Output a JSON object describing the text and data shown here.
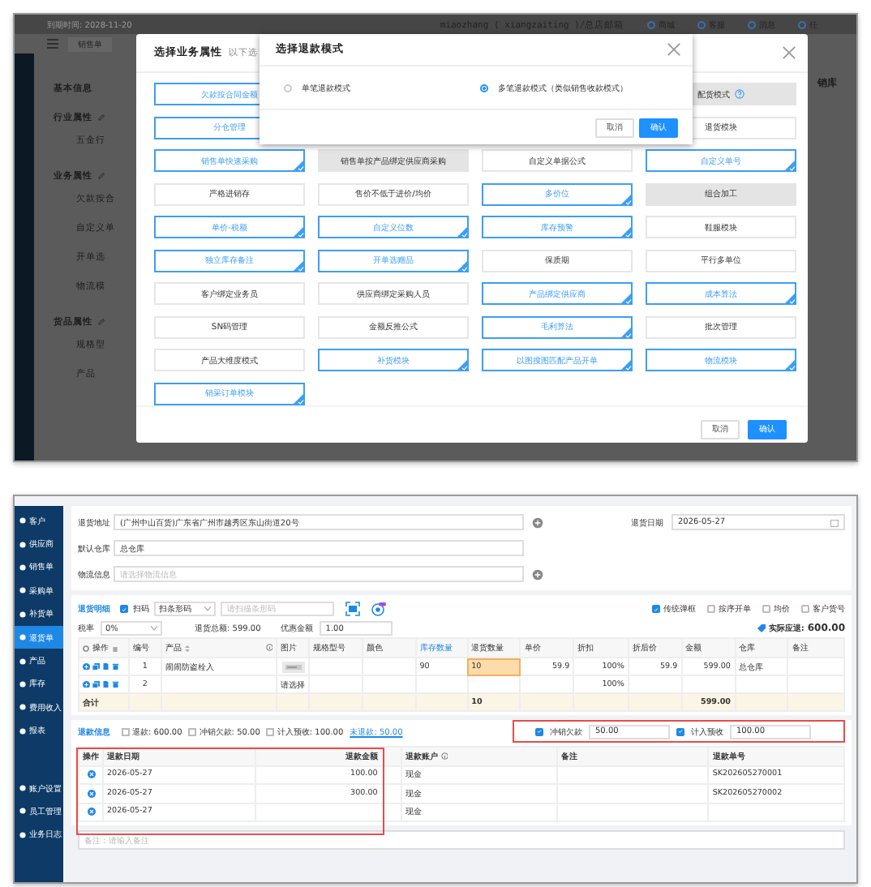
{
  "top_screen": {
    "background_page": {
      "expiry": "到期时间: 2028-11-20",
      "user": "miaozhang ( xiangzaiting )/总店邮箱",
      "nav": [
        "商城",
        "客服",
        "消息",
        "任"
      ],
      "tab": "销售单",
      "sections": [
        {
          "title": "基本信息",
          "editable": false
        },
        {
          "title": "行业属性",
          "editable": true,
          "fields": [
            "五金行"
          ]
        },
        {
          "title": "业务属性",
          "editable": true,
          "fields": [
            "欠款按合",
            "自定义单",
            "开单选",
            "物流模"
          ]
        },
        {
          "title": "货品属性",
          "editable": true,
          "fields": [
            "规格型",
            "产品"
          ]
        }
      ],
      "right_label": "销库"
    },
    "attribute_dialog": {
      "title": "选择业务属性",
      "subtitle": "以下选",
      "rows": [
        [
          {
            "label": "欠款按合同金额",
            "selected": true,
            "disabled": false
          },
          {
            "label": "配货模式",
            "selected": false,
            "disabled": true,
            "help": true
          }
        ],
        [
          {
            "label": "分仓管理",
            "selected": true,
            "disabled": false
          },
          {
            "label": "退货模块",
            "selected": false,
            "disabled": false
          }
        ],
        [
          {
            "label": "销售单快速采购",
            "selected": true,
            "disabled": false
          },
          {
            "label": "销售单按产品绑定供应商采购",
            "selected": false,
            "disabled": true
          },
          {
            "label": "自定义单据公式",
            "selected": false,
            "disabled": false
          },
          {
            "label": "自定义单号",
            "selected": true,
            "disabled": false
          }
        ],
        [
          {
            "label": "严格进销存",
            "selected": false,
            "disabled": false
          },
          {
            "label": "售价不低于进价/均价",
            "selected": false,
            "disabled": false
          },
          {
            "label": "多价位",
            "selected": true,
            "disabled": false
          },
          {
            "label": "组合加工",
            "selected": false,
            "disabled": true
          }
        ],
        [
          {
            "label": "单价-税额",
            "selected": true,
            "disabled": false
          },
          {
            "label": "自定义位数",
            "selected": true,
            "disabled": false
          },
          {
            "label": "库存预警",
            "selected": true,
            "disabled": false
          },
          {
            "label": "鞋服模块",
            "selected": false,
            "disabled": false
          }
        ],
        [
          {
            "label": "独立库存备注",
            "selected": true,
            "disabled": false
          },
          {
            "label": "开单选赠品",
            "selected": true,
            "disabled": false
          },
          {
            "label": "保质期",
            "selected": false,
            "disabled": false
          },
          {
            "label": "平行多单位",
            "selected": false,
            "disabled": false
          }
        ],
        [
          {
            "label": "客户绑定业务员",
            "selected": false,
            "disabled": false
          },
          {
            "label": "供应商绑定采购人员",
            "selected": false,
            "disabled": false
          },
          {
            "label": "产品绑定供应商",
            "selected": true,
            "disabled": false
          },
          {
            "label": "成本算法",
            "selected": true,
            "disabled": false
          }
        ],
        [
          {
            "label": "SN码管理",
            "selected": false,
            "disabled": false
          },
          {
            "label": "金额反推公式",
            "selected": false,
            "disabled": false
          },
          {
            "label": "毛利算法",
            "selected": true,
            "disabled": false
          },
          {
            "label": "批次管理",
            "selected": false,
            "disabled": false
          }
        ],
        [
          {
            "label": "产品大维度模式",
            "selected": false,
            "disabled": false
          },
          {
            "label": "补货模块",
            "selected": true,
            "disabled": false
          },
          {
            "label": "以图搜图匹配产品开单",
            "selected": true,
            "disabled": false
          },
          {
            "label": "物流模块",
            "selected": true,
            "disabled": false
          }
        ],
        [
          {
            "label": "销采订单模块",
            "selected": true,
            "disabled": false
          }
        ]
      ],
      "buttons": [
        {
          "label": "取消",
          "kind": "secondary"
        },
        {
          "label": "确认",
          "kind": "primary"
        }
      ]
    },
    "refund_mode_dialog": {
      "title": "选择退款模式",
      "options": [
        {
          "label": "单笔退款模式",
          "selected": false
        },
        {
          "label": "多笔退款模式（类似销售收款模式）",
          "selected": true
        }
      ],
      "buttons": [
        {
          "label": "取消",
          "kind": "secondary"
        },
        {
          "label": "确认",
          "kind": "primary"
        }
      ]
    }
  },
  "bottom_screen": {
    "sidebar": [
      {
        "label": "客户",
        "selected": false
      },
      {
        "label": "供应商",
        "selected": false
      },
      {
        "label": "销售单",
        "selected": false
      },
      {
        "label": "采购单",
        "selected": false
      },
      {
        "label": "补货单",
        "selected": false
      },
      {
        "label": "退货单",
        "selected": true
      },
      {
        "label": "产品",
        "selected": false
      },
      {
        "label": "库存",
        "selected": false
      },
      {
        "label": "费用收入",
        "selected": false
      },
      {
        "label": "报表",
        "selected": false
      },
      {
        "label": "账户设置",
        "selected": false
      },
      {
        "label": "员工管理",
        "selected": false
      },
      {
        "label": "业务日志",
        "selected": false
      }
    ],
    "form": {
      "address": {
        "label": "退货地址",
        "value": "(广州中山百货)广东省广州市越秀区东山街道20号"
      },
      "date": {
        "label": "退货日期",
        "value": "2026-05-27"
      },
      "warehouse": {
        "label": "默认仓库",
        "value": "总仓库"
      },
      "logistics": {
        "label": "物流信息",
        "placeholder": "请选择物流信息"
      }
    },
    "toolbar": {
      "title": "退货明细",
      "scan": {
        "label": "扫码",
        "checked": true
      },
      "scan_mode": "扫条形码",
      "barcode_placeholder": "请扫描条形码",
      "options": [
        {
          "label": "传统弹框",
          "checked": true
        },
        {
          "label": "按序开单",
          "checked": false
        },
        {
          "label": "均价",
          "checked": false
        },
        {
          "label": "客户货号",
          "checked": false
        }
      ]
    },
    "totals": {
      "tax_label": "税率",
      "tax_value": "0%",
      "total": "退货总额: 599.00",
      "discount_label": "优惠金额",
      "discount_value": "1.00",
      "actual_label": "实际应退:",
      "actual_value": "600.00"
    },
    "items_table": {
      "columns": [
        {
          "label": "操作",
          "link": false
        },
        {
          "label": "编号",
          "link": false
        },
        {
          "label": "产品",
          "link": false
        },
        {
          "label": "图片",
          "link": false
        },
        {
          "label": "规格型号",
          "link": false
        },
        {
          "label": "颜色",
          "link": false
        },
        {
          "label": "库存数量",
          "link": true
        },
        {
          "label": "退货数量",
          "link": false
        },
        {
          "label": "单价",
          "link": false
        },
        {
          "label": "折扣",
          "link": false
        },
        {
          "label": "折后价",
          "link": false
        },
        {
          "label": "金额",
          "link": false
        },
        {
          "label": "仓库",
          "link": false
        },
        {
          "label": "备注",
          "link": false
        }
      ],
      "rows": [
        {
          "number": "1",
          "product": "闹闹防盗栓入",
          "stock": "90",
          "quantity": "10",
          "price": "59.9",
          "discount": "100%",
          "net_price": "59.9",
          "amount": "599.00",
          "warehouse": "总仓库",
          "quantity_editing": true
        },
        {
          "number": "2",
          "image": {
            "kind": "text",
            "text": "请选择"
          },
          "discount": "100%",
          "quantity_editing": false
        }
      ],
      "footer": {
        "label": "合计",
        "quantity": "10",
        "amount": "599.00"
      }
    },
    "refund_info": {
      "title": "退款信息",
      "summary": [
        {
          "label": "退款:",
          "value": "600.00",
          "checked": false
        },
        {
          "label": "冲销欠款:",
          "value": "50.00",
          "checked": false
        },
        {
          "label": "计入预收:",
          "value": "100.00",
          "checked": false
        }
      ],
      "unrefunded": "未退款: 50.00",
      "options": [
        {
          "label": "冲销欠款",
          "checked": true,
          "value": "50.00"
        },
        {
          "label": "计入预收",
          "checked": true,
          "value": "100.00"
        }
      ]
    },
    "refund_table": {
      "columns": [
        "操作",
        "退款日期",
        "退款金额",
        "退款账户",
        "备注",
        "退款单号"
      ],
      "rows": [
        {
          "date": "2026-05-27",
          "amount": "100.00",
          "account": "现金",
          "number": "SK202605270001"
        },
        {
          "date": "2026-05-27",
          "amount": "300.00",
          "account": "现金",
          "number": "SK202605270002"
        },
        {
          "date": "2026-05-27",
          "account": "现金"
        }
      ]
    },
    "remark": {
      "placeholder": "备注：请输入备注"
    }
  }
}
